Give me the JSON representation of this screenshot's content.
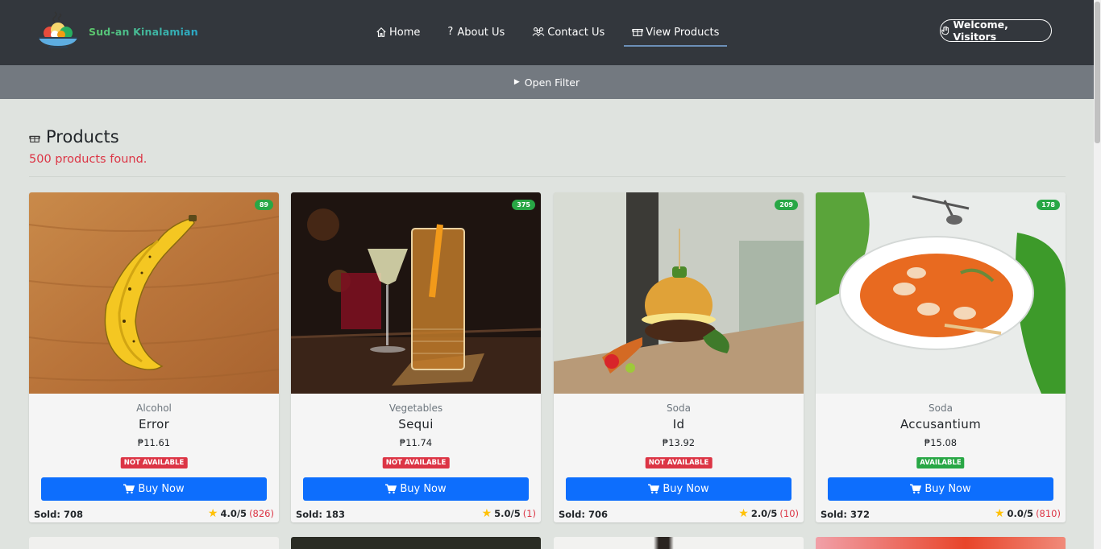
{
  "brand": {
    "name": "Sud-an Kinalamian"
  },
  "nav": {
    "items": [
      {
        "label": "Home",
        "icon": "home-icon"
      },
      {
        "label": "About Us",
        "icon": "question-icon"
      },
      {
        "label": "Contact Us",
        "icon": "people-icon"
      },
      {
        "label": "View Products",
        "icon": "box-icon",
        "active": true
      }
    ],
    "welcome_label": "Welcome, Visitors"
  },
  "filter": {
    "toggle_label": "Open Filter"
  },
  "products_section": {
    "title": "Products",
    "found_text": "500 products found."
  },
  "products": [
    {
      "stock": "89",
      "category": "Alcohol",
      "name": "Error",
      "price": "₱11.61",
      "status": "NOT AVAILABLE",
      "buy_label": "Buy Now",
      "sold": "Sold: 708",
      "rating": "4.0/5",
      "rating_count": "(826)"
    },
    {
      "stock": "375",
      "category": "Vegetables",
      "name": "Sequi",
      "price": "₱11.74",
      "status": "NOT AVAILABLE",
      "buy_label": "Buy Now",
      "sold": "Sold: 183",
      "rating": "5.0/5",
      "rating_count": "(1)"
    },
    {
      "stock": "209",
      "category": "Soda",
      "name": "Id",
      "price": "₱13.92",
      "status": "NOT AVAILABLE",
      "buy_label": "Buy Now",
      "sold": "Sold: 706",
      "rating": "2.0/5",
      "rating_count": "(10)"
    },
    {
      "stock": "178",
      "category": "Soda",
      "name": "Accusantium",
      "price": "₱15.08",
      "status": "AVAILABLE",
      "buy_label": "Buy Now",
      "sold": "Sold: 372",
      "rating": "0.0/5",
      "rating_count": "(810)"
    }
  ],
  "colors": {
    "navbar": "#33373d",
    "filterbar": "#737980",
    "background": "#dfe3df",
    "primary": "#0d6efd",
    "danger": "#dc3545",
    "success": "#28a745",
    "star": "#ffc107"
  }
}
